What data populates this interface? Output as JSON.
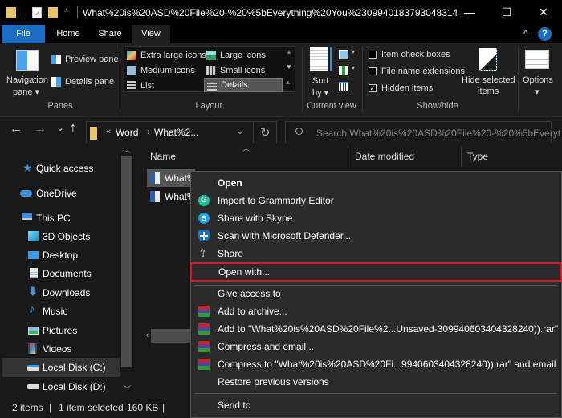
{
  "window": {
    "title": "What%20is%20ASD%20File%20-%20%5bEverything%20You%2309940183793048314",
    "minimize": "—",
    "maximize": "☐",
    "close": "✕"
  },
  "tabs": [
    {
      "label": "File",
      "active_color": "#1a6fc4"
    },
    {
      "label": "Home"
    },
    {
      "label": "Share"
    },
    {
      "label": "View",
      "selected": true
    }
  ],
  "ribbon": {
    "collapse_icon": "^",
    "help_icon": "?",
    "panes": {
      "group": "Panes",
      "navigation_pane": "Navigation",
      "navigation_pane_2": "pane ▾",
      "preview_pane": "Preview pane",
      "details_pane": "Details pane"
    },
    "layout": {
      "group": "Layout",
      "options": [
        "Extra large icons",
        "Large icons",
        "Medium icons",
        "Small icons",
        "List",
        "Details"
      ],
      "selected": "Details"
    },
    "current_view": {
      "group": "Current view",
      "sort_by": "Sort",
      "sort_by_2": "by ▾"
    },
    "show_hide": {
      "group": "Show/hide",
      "item_check_boxes": {
        "label": "Item check boxes",
        "checked": false
      },
      "file_name_extensions": {
        "label": "File name extensions",
        "checked": false
      },
      "hidden_items": {
        "label": "Hidden items",
        "checked": true
      },
      "hide_selected": "Hide selected",
      "hide_selected_2": "items"
    },
    "options": {
      "label": "Options",
      "arrow": "▾"
    }
  },
  "nav": {
    "back": "←",
    "forward": "→",
    "recent": "⌄",
    "up": "↑",
    "breadcrumb_overflow": "«",
    "crumbs": [
      "Word",
      "What%2..."
    ],
    "crumb_sep": "›",
    "dropdown": "⌄",
    "refresh": "↻",
    "search_placeholder": "Search What%20is%20ASD%20File%20-%20%5bEveryt..."
  },
  "sidebar": {
    "items": [
      {
        "label": "Quick access",
        "icon": "star-icon"
      },
      {
        "label": "OneDrive",
        "icon": "cloud-icon"
      },
      {
        "label": "This PC",
        "icon": "pc-icon"
      },
      {
        "label": "3D Objects",
        "icon": "cube-icon"
      },
      {
        "label": "Desktop",
        "icon": "desktop-icon"
      },
      {
        "label": "Documents",
        "icon": "document-icon"
      },
      {
        "label": "Downloads",
        "icon": "download-icon"
      },
      {
        "label": "Music",
        "icon": "music-icon"
      },
      {
        "label": "Pictures",
        "icon": "picture-icon"
      },
      {
        "label": "Videos",
        "icon": "video-icon"
      },
      {
        "label": "Local Disk (C:)",
        "icon": "drive-icon",
        "selected": true
      },
      {
        "label": "Local Disk (D:)",
        "icon": "drive-icon"
      }
    ]
  },
  "columns": [
    "Name",
    "Date modified",
    "Type"
  ],
  "files": [
    {
      "name": "What%",
      "selected": true
    },
    {
      "name": "What%",
      "selected": false
    }
  ],
  "status": {
    "items": "2 items",
    "selected": "1 item selected",
    "size": "160 KB",
    "sep": "|"
  },
  "context_menu": {
    "highlight_color": "#e81123",
    "items": [
      {
        "label": "Open",
        "bold": true
      },
      {
        "label": "Import to Grammarly Editor",
        "icon": "grammarly-icon"
      },
      {
        "label": "Share with Skype",
        "icon": "skype-icon"
      },
      {
        "label": "Scan with Microsoft Defender...",
        "icon": "defender-icon"
      },
      {
        "label": "Share",
        "icon": "share-icon"
      },
      {
        "label": "Open with...",
        "highlighted": true
      },
      {
        "label": "Give access to"
      },
      {
        "label": "Add to archive...",
        "icon": "winrar-icon"
      },
      {
        "label": "Add to \"What%20is%20ASD%20File%2...Unsaved-309940603404328240)).rar\"",
        "icon": "winrar-icon"
      },
      {
        "label": "Compress and email...",
        "icon": "winrar-icon"
      },
      {
        "label": "Compress to \"What%20is%20ASD%20Fi...9940603404328240)).rar\" and email",
        "icon": "winrar-icon"
      },
      {
        "label": "Restore previous versions"
      },
      {
        "label": "Send to"
      }
    ]
  }
}
